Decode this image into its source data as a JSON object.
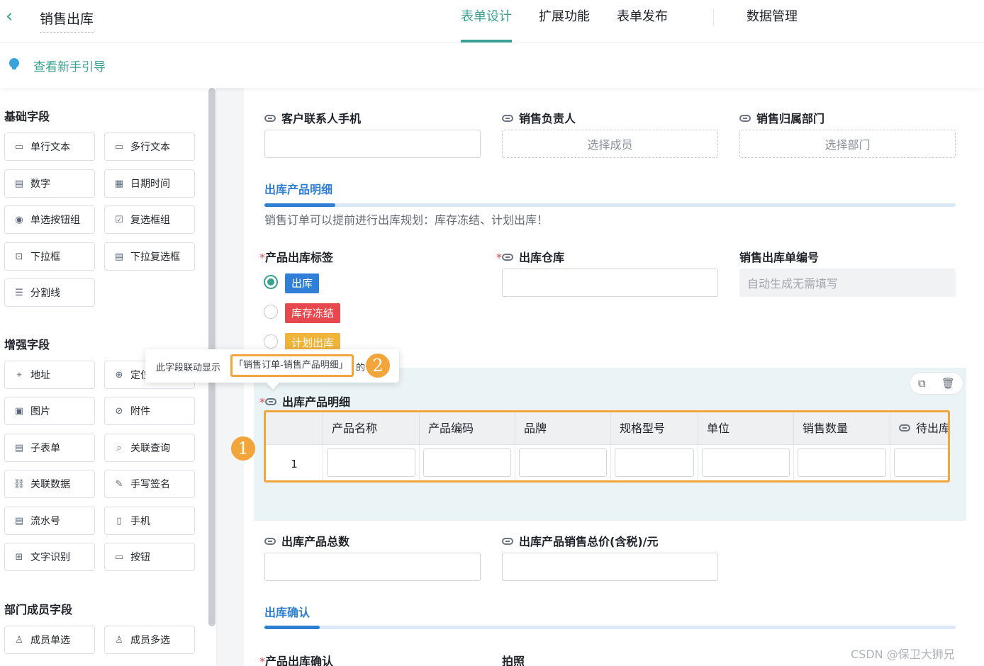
{
  "header": {
    "title": "销售出库",
    "tabs": [
      "表单设计",
      "扩展功能",
      "表单发布"
    ],
    "data_tab": "数据管理"
  },
  "guide": {
    "label": "查看新手引导"
  },
  "sidebar": {
    "basic_title": "基础字段",
    "basic": [
      {
        "label": "单行文本",
        "icon": "single-line-text-icon"
      },
      {
        "label": "多行文本",
        "icon": "multi-line-text-icon"
      },
      {
        "label": "数字",
        "icon": "number-icon"
      },
      {
        "label": "日期时间",
        "icon": "calendar-icon"
      },
      {
        "label": "单选按钮组",
        "icon": "radio-icon"
      },
      {
        "label": "复选框组",
        "icon": "checkbox-icon"
      },
      {
        "label": "下拉框",
        "icon": "dropdown-icon"
      },
      {
        "label": "下拉复选框",
        "icon": "dropdown-multi-icon"
      },
      {
        "label": "分割线",
        "icon": "divider-icon"
      }
    ],
    "enhanced_title": "增强字段",
    "enhanced": [
      {
        "label": "地址",
        "icon": "location-pin-icon"
      },
      {
        "label": "定位",
        "icon": "crosshair-icon"
      },
      {
        "label": "图片",
        "icon": "image-icon"
      },
      {
        "label": "附件",
        "icon": "attachment-icon"
      },
      {
        "label": "子表单",
        "icon": "subform-icon"
      },
      {
        "label": "关联查询",
        "icon": "search-link-icon"
      },
      {
        "label": "关联数据",
        "icon": "link-data-icon"
      },
      {
        "label": "手写签名",
        "icon": "pen-icon"
      },
      {
        "label": "流水号",
        "icon": "serial-number-icon"
      },
      {
        "label": "手机",
        "icon": "phone-icon"
      },
      {
        "label": "文字识别",
        "icon": "ocr-icon"
      },
      {
        "label": "按钮",
        "icon": "button-icon"
      }
    ],
    "member_title": "部门成员字段",
    "member": [
      {
        "label": "成员单选",
        "icon": "user-icon"
      },
      {
        "label": "成员多选",
        "icon": "users-icon"
      }
    ]
  },
  "form": {
    "customer_phone_label": "客户联系人手机",
    "sales_owner_label": "销售负责人",
    "sales_owner_placeholder": "选择成员",
    "sales_dept_label": "销售归属部门",
    "sales_dept_placeholder": "选择部门",
    "section1_title": "出库产品明细",
    "section1_desc": "销售订单可以提前进行出库规划：库存冻结、计划出库！",
    "tag_label": "产品出库标签",
    "tag_options": [
      {
        "label": "出库",
        "color": "#2f7fd8",
        "selected": true
      },
      {
        "label": "库存冻结",
        "color": "#e8484d",
        "selected": false
      },
      {
        "label": "计划出库",
        "color": "#f0b43a",
        "selected": false
      }
    ],
    "warehouse_label": "出库仓库",
    "order_no_label": "销售出库单编号",
    "order_no_placeholder": "自动生成无需填写",
    "subtable_label": "出库产品明细",
    "subtable_columns": [
      "产品名称",
      "产品编码",
      "品牌",
      "规格型号",
      "单位",
      "销售数量",
      "待出库数"
    ],
    "subtable_row_number": "1",
    "total_count_label": "出库产品总数",
    "total_price_label": "出库产品销售总价(含税)/元",
    "section2_title": "出库确认",
    "confirm_label": "产品出库确认",
    "photo_label": "拍照"
  },
  "tooltip": {
    "prefix": "此字段联动显示",
    "highlight": "「销售订单-销售产品明细」",
    "suffix": "的"
  },
  "badges": {
    "one": "1",
    "two": "2"
  },
  "watermark": "CSDN @保卫大狮兄",
  "colors": {
    "accent": "#3aa192",
    "section": "#2e7fd4",
    "highlight": "#f2a53a"
  }
}
